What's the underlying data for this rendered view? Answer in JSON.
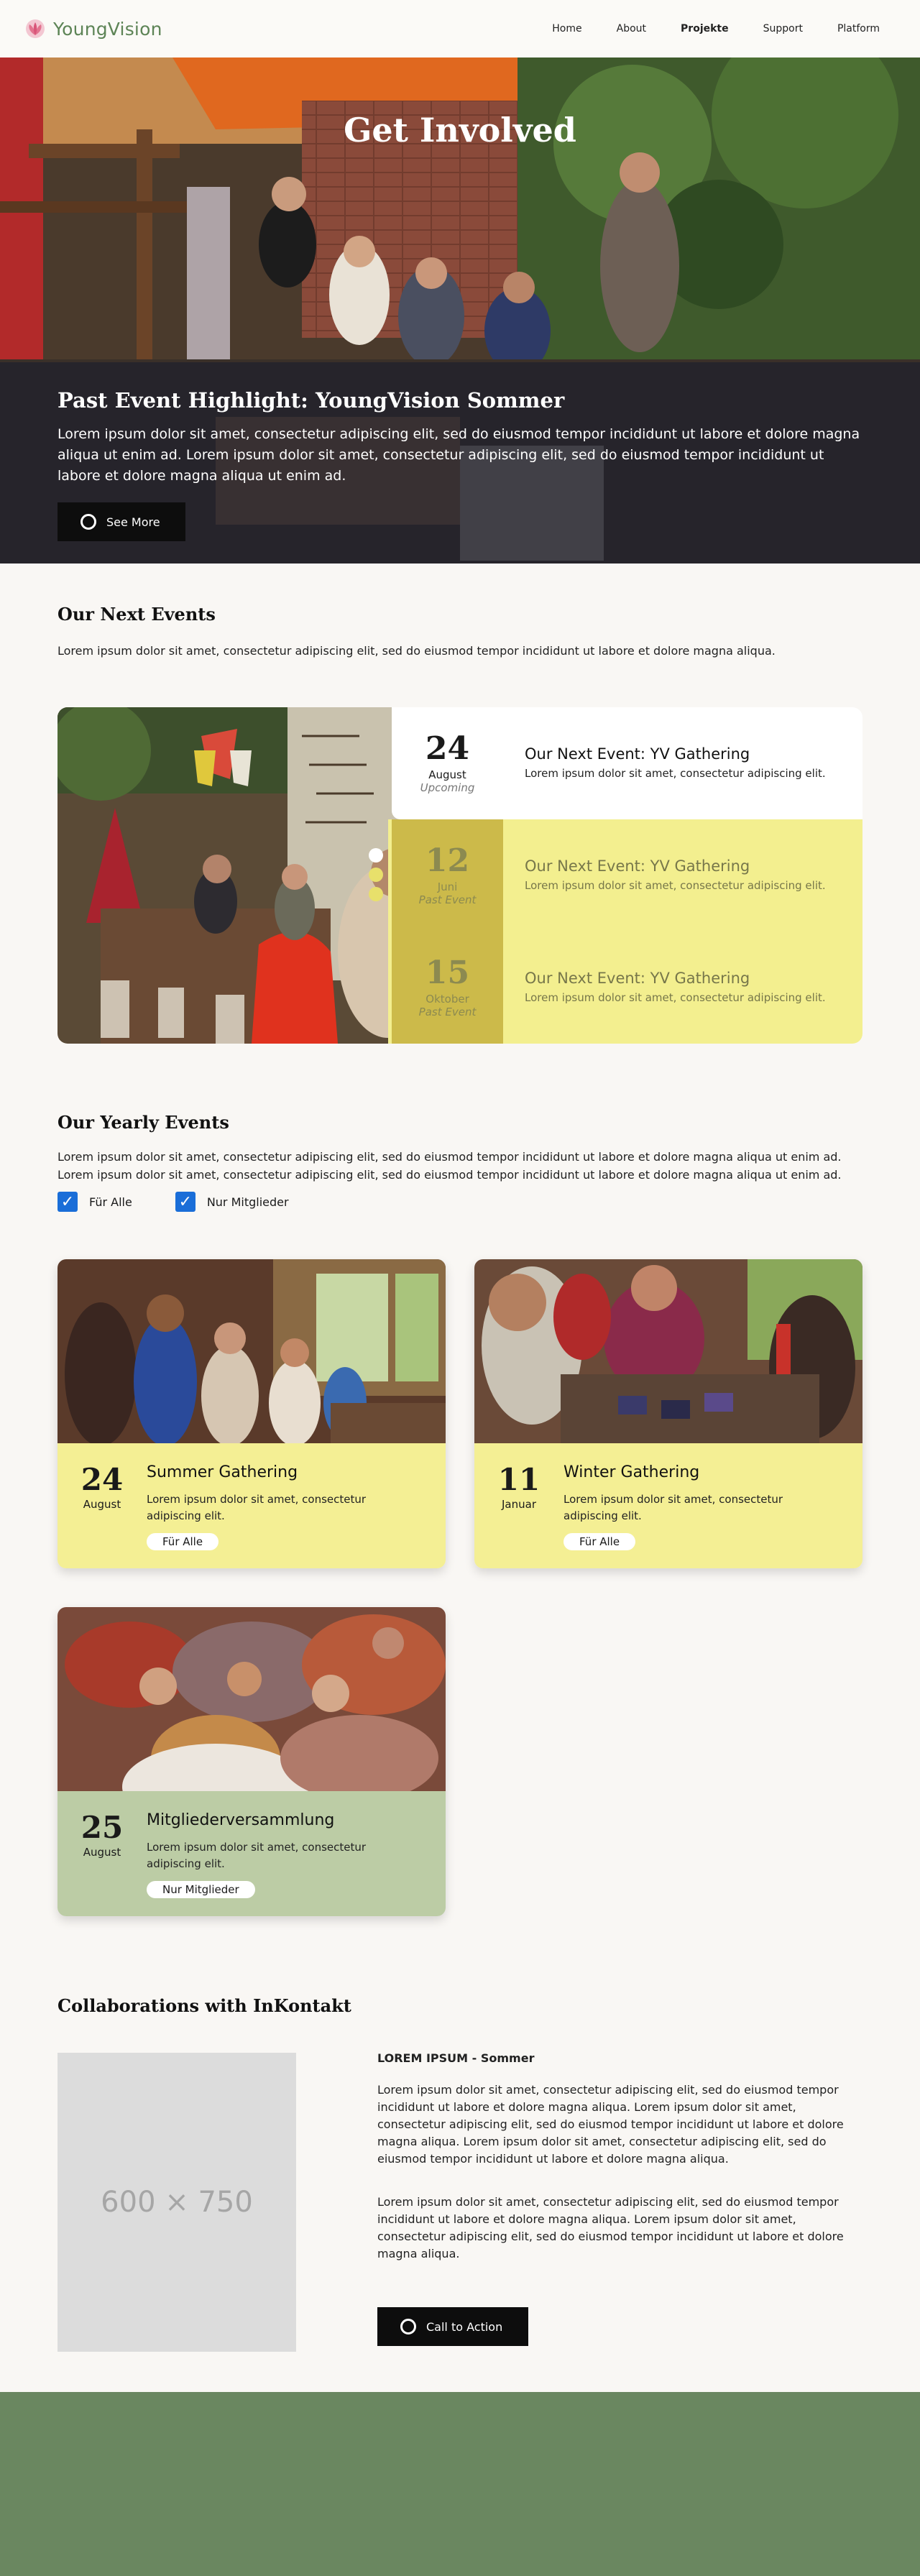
{
  "nav": {
    "logo_text": "YoungVision",
    "links": [
      {
        "label": "Home"
      },
      {
        "label": "About"
      },
      {
        "label": "Projekte"
      },
      {
        "label": "Support"
      },
      {
        "label": "Platform"
      }
    ]
  },
  "hero": {
    "title": "Get Involved",
    "highlight_title": "Past Event Highlight: YoungVision Sommer",
    "highlight_text": "Lorem ipsum dolor sit amet, consectetur adipiscing elit, sed do eiusmod tempor incididunt ut labore et dolore magna aliqua ut enim ad. Lorem ipsum dolor sit amet, consectetur adipiscing elit, sed do eiusmod tempor incididunt ut labore et dolore magna aliqua ut enim ad.",
    "button_label": "See More"
  },
  "next_events": {
    "title": "Our Next Events",
    "text": "Lorem ipsum dolor sit amet, consectetur adipiscing elit, sed do eiusmod tempor incididunt ut labore et dolore magna aliqua.",
    "events": [
      {
        "day": "24",
        "month": "August",
        "status": "Upcoming",
        "title": "Our Next Event: YV Gathering",
        "text": "Lorem ipsum dolor sit amet, consectetur adipiscing elit."
      },
      {
        "day": "12",
        "month": "Juni",
        "status": "Past Event",
        "title": "Our Next Event: YV Gathering",
        "text": "Lorem ipsum dolor sit amet, consectetur adipiscing elit."
      },
      {
        "day": "15",
        "month": "Oktober",
        "status": "Past Event",
        "title": "Our Next Event: YV Gathering",
        "text": "Lorem ipsum dolor sit amet, consectetur adipiscing elit."
      }
    ]
  },
  "yearly": {
    "title": "Our Yearly Events",
    "text": "Lorem ipsum dolor sit amet, consectetur adipiscing elit, sed do eiusmod tempor incididunt ut labore et dolore magna aliqua ut enim ad. Lorem ipsum dolor sit amet, consectetur adipiscing elit, sed do eiusmod tempor incididunt ut labore et dolore magna aliqua ut enim ad.",
    "filters": [
      {
        "label": "Für Alle",
        "checked": true
      },
      {
        "label": "Nur Mitglieder",
        "checked": true
      }
    ],
    "cards": [
      {
        "day": "24",
        "month": "August",
        "title": "Summer Gathering",
        "text": "Lorem ipsum dolor sit amet, consectetur adipiscing elit.",
        "tag": "Für Alle",
        "color": "#f4ef94"
      },
      {
        "day": "11",
        "month": "Januar",
        "title": "Winter Gathering",
        "text": "Lorem ipsum dolor sit amet, consectetur adipiscing elit.",
        "tag": "Für Alle",
        "color": "#f4ef94"
      },
      {
        "day": "25",
        "month": "August",
        "title": "Mitgliederversammlung",
        "text": "Lorem ipsum dolor sit amet, consectetur adipiscing elit.",
        "tag": "Nur Mitglieder",
        "color": "#bccca5"
      }
    ]
  },
  "collab": {
    "title": "Collaborations with InKontakt",
    "placeholder": "600 × 750",
    "subtitle": "LOREM IPSUM - Sommer",
    "para1": "Lorem ipsum dolor sit amet, consectetur adipiscing elit, sed do eiusmod tempor incididunt ut labore et dolore magna aliqua. Lorem ipsum dolor sit amet, consectetur adipiscing elit, sed do eiusmod tempor incididunt ut labore et dolore magna aliqua. Lorem ipsum dolor sit amet, consectetur adipiscing elit, sed do eiusmod tempor incididunt ut labore et dolore magna aliqua.",
    "para2": "Lorem ipsum dolor sit amet, consectetur adipiscing elit, sed do eiusmod tempor incididunt ut labore et dolore magna aliqua. Lorem ipsum dolor sit amet, consectetur adipiscing elit, sed do eiusmod tempor incididunt ut labore et dolore magna aliqua.",
    "button_label": "Call to Action"
  },
  "colors": {
    "brand_green": "#5d8456",
    "footer_green": "#6a8760",
    "yellow": "#f3ef8f",
    "sage": "#bccca5",
    "checkbox_blue": "#1a6ed8"
  }
}
